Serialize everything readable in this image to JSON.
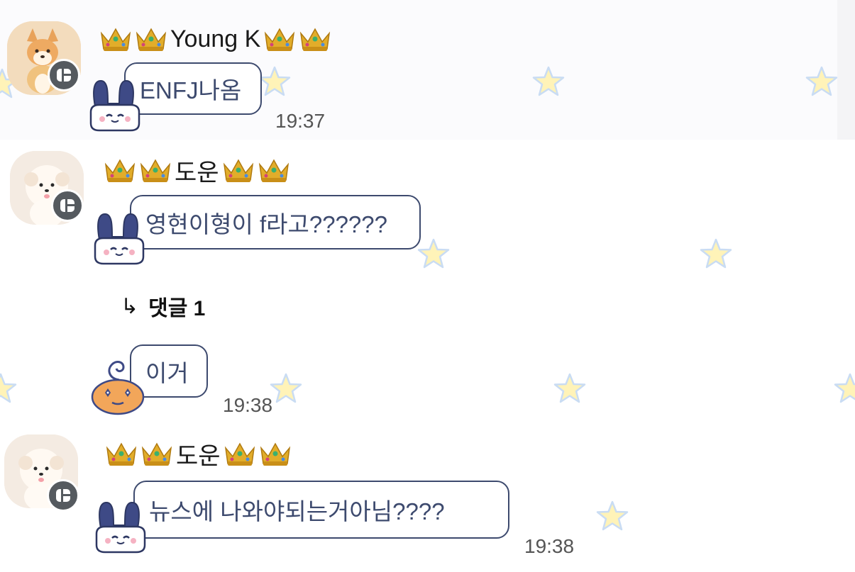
{
  "messages": [
    {
      "sender": "Young K",
      "text": "ENFJ나옴",
      "time": "19:37"
    },
    {
      "sender": "도운",
      "text": "영현이형이 f라고??????"
    },
    {
      "sender": "",
      "text": "이거",
      "time": "19:38"
    },
    {
      "sender": "도운",
      "text": "뉴스에 나와야되는거아님????",
      "time": "19:38"
    }
  ],
  "reply": {
    "arrow": "↳",
    "label": "댓글 1"
  },
  "colors": {
    "bubble_border": "#3d4a6e",
    "badge": "#555a5f",
    "star": "#fff3b8"
  },
  "icons": {
    "crown": "crown-icon",
    "star": "star-icon",
    "badge": "app-badge-icon"
  }
}
